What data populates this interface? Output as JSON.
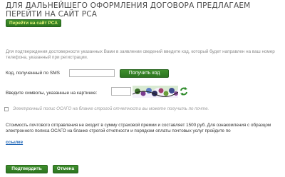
{
  "heading": "Для дальнейшего оформления договора предлагаем перейти на сайт РСА",
  "rca_button": "Перейти на сайт РСА",
  "info_text": "Для подтверждения достоверности указанных Вами в заявлении сведений введите код, который будет направлен на ваш номер телефона, указанный при регистрации.",
  "sms": {
    "label": "Код, полученный по SMS",
    "value": "",
    "button": "Получить код"
  },
  "captcha": {
    "label": "Введите символы, указанные на картинке:",
    "value": "",
    "refresh_icon": "refresh-arrows-icon"
  },
  "paper_policy": {
    "label": "Электронный полис ОСАГО на бланке строгой отчетности вы можете получить по почте.",
    "checked": false
  },
  "postage_text": "Стоимость почтового отправления не входит в сумму страховой премии и составляет 1500 руб. Для ознакомления с образцом электронного полиса ОСАГО на бланке строгой отчетности и порядком оплаты почтовых услуг пройдите по",
  "link_text": "ссылке",
  "actions": {
    "confirm": "Подтвердить",
    "cancel": "Отмена"
  },
  "colors": {
    "button_green": "#2f7d24",
    "link_blue": "#1a62b5",
    "muted_text": "#8a8a8a"
  }
}
